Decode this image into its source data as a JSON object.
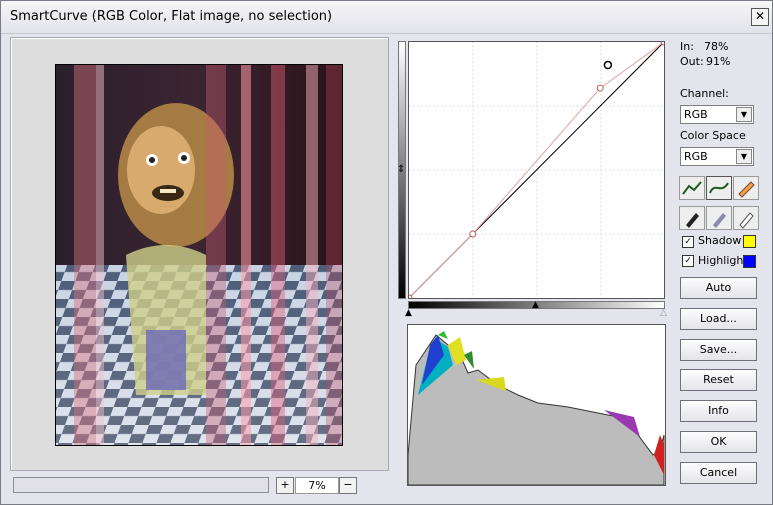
{
  "window": {
    "title": "SmartCurve (RGB Color, Flat image, no selection)",
    "close_label": "✕"
  },
  "readout": {
    "in_label": "In:",
    "in_value": "78%",
    "out_label": "Out:",
    "out_value": "91%"
  },
  "channel": {
    "label": "Channel:",
    "value": "RGB"
  },
  "color_space": {
    "label": "Color Space",
    "value": "RGB"
  },
  "tools": [
    "curve-smooth-icon",
    "curve-spline-icon",
    "pencil-icon",
    "eyedropper-black-icon",
    "eyedropper-gray-icon",
    "eyedropper-white-icon"
  ],
  "options": {
    "shadow": {
      "label": "Shadow",
      "checked": true,
      "color": "#ffff00"
    },
    "highlight": {
      "label": "Highlight",
      "checked": true,
      "color": "#0000ff"
    }
  },
  "buttons": {
    "auto": "Auto",
    "load": "Load...",
    "save": "Save...",
    "reset": "Reset",
    "info": "Info",
    "ok": "OK",
    "cancel": "Cancel"
  },
  "zoom": {
    "value": "7%",
    "plus": "+",
    "minus": "−"
  },
  "curve": {
    "points_in": [
      0,
      25,
      75,
      100
    ],
    "points_out": [
      0,
      25,
      75,
      100
    ],
    "adjusted_points_in": [
      0,
      25,
      75,
      100
    ],
    "adjusted_points_out": [
      0,
      25,
      82,
      100
    ],
    "selected_point": {
      "in": 78,
      "out": 91
    }
  },
  "colors": {
    "accent": "#e6a0a0",
    "curve": "#000000",
    "histogram_fill": "#bcbcbc"
  }
}
